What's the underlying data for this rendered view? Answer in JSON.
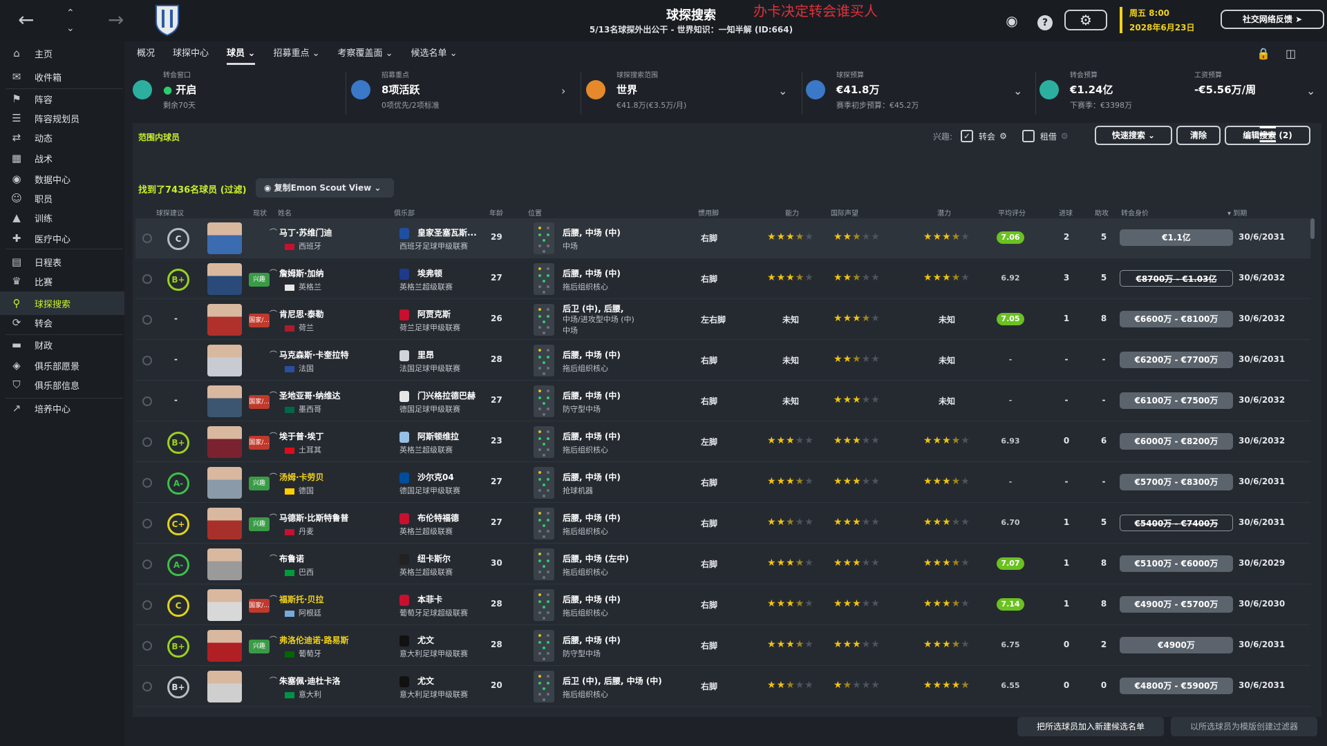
{
  "topbar": {
    "title": "球探搜索",
    "subtitle": "5/13名球探外出公干 - 世界知识：一知半解 (ID:664)",
    "overlay": "办卡决定转会谁买人",
    "date_line1": "周五 8:00",
    "date_line2": "2028年6月23日",
    "feedback": "社交网络反馈"
  },
  "sidebar": {
    "items": [
      {
        "label": "主页",
        "icon": "home-icon"
      },
      {
        "label": "收件箱",
        "icon": "inbox-icon"
      },
      {
        "label": "阵容",
        "icon": "shirt-icon"
      },
      {
        "label": "阵容规划员",
        "icon": "clipboard-icon"
      },
      {
        "label": "动态",
        "icon": "dynamics-icon"
      },
      {
        "label": "战术",
        "icon": "tactics-icon"
      },
      {
        "label": "数据中心",
        "icon": "data-icon"
      },
      {
        "label": "职员",
        "icon": "staff-icon"
      },
      {
        "label": "训练",
        "icon": "training-icon"
      },
      {
        "label": "医疗中心",
        "icon": "medical-icon"
      },
      {
        "label": "日程表",
        "icon": "calendar-icon"
      },
      {
        "label": "比赛",
        "icon": "trophy-icon"
      },
      {
        "label": "球探搜索",
        "icon": "search-icon"
      },
      {
        "label": "转会",
        "icon": "transfer-icon"
      },
      {
        "label": "财政",
        "icon": "finance-icon"
      },
      {
        "label": "俱乐部愿景",
        "icon": "vision-icon"
      },
      {
        "label": "俱乐部信息",
        "icon": "shield-icon"
      },
      {
        "label": "培养中心",
        "icon": "development-icon"
      }
    ]
  },
  "tabs": [
    "概况",
    "球探中心",
    "球员 ⌄",
    "招募重点 ⌄",
    "考察覆盖面 ⌄",
    "候选名单 ⌄"
  ],
  "summary": {
    "window": {
      "label": "转会窗口",
      "value": "开启",
      "sub": "剩余70天"
    },
    "focus": {
      "label": "招募重点",
      "value": "8项活跃",
      "sub": "0项优先/2项标准"
    },
    "range": {
      "label": "球探搜索范围",
      "value": "世界",
      "sub": "€41.8万(€3.5万/月)"
    },
    "budget": {
      "label": "球探预算",
      "value": "€41.8万",
      "sub": "赛季初步预算：€45.2万"
    },
    "transfer": {
      "label": "转会预算",
      "value": "€1.24亿",
      "sub": "下赛季：€3398万"
    },
    "wage": {
      "label": "工资预算",
      "value": "-€5.56万/周"
    }
  },
  "filters": {
    "in_range": "范围内球员",
    "interest_label": "兴趣:",
    "transfer": "转会",
    "loan": "租借",
    "quick_search": "快速搜索 ⌄",
    "clear": "清除",
    "edit_search": "编辑搜索 (2)"
  },
  "found": "找到了7436名球员 (过滤)",
  "view_button": "复制Emon Scout View ⌄",
  "headers": {
    "advice": "球探建议",
    "status": "现状",
    "name": "姓名",
    "club": "俱乐部",
    "age": "年龄",
    "position": "位置",
    "foot": "惯用脚",
    "ability": "能力",
    "reputation": "国际声望",
    "potential": "潜力",
    "avg": "平均评分",
    "goals": "进球",
    "assists": "助攻",
    "value": "转会身价",
    "expiry": "▾ 到期"
  },
  "players": [
    {
      "grade": "C",
      "gcolor": "#b8bcc1",
      "tag": "",
      "name": "马丁·苏维门迪",
      "fav": false,
      "nation": "西班牙",
      "fcol": "#c8102e",
      "club": "皇家圣塞瓦斯...",
      "league": "西班牙足球甲级联赛",
      "ccol": "#1f4fa0",
      "age": "29",
      "pos1": "后腰, 中场 (中)",
      "pos2": "中场",
      "foot": "右脚",
      "ability": 3.5,
      "rep": 2.5,
      "pot": 3.5,
      "avg": "7.06",
      "avgg": true,
      "goals": "2",
      "assists": "5",
      "value": "€1.1亿",
      "vstyle": "solid",
      "expiry": "30/6/2031",
      "photo": "#3b6bb0"
    },
    {
      "grade": "B+",
      "gcolor": "#9bd11e",
      "tag": "兴趣",
      "tagc": "#3a9b46",
      "name": "詹姆斯·加纳",
      "fav": false,
      "nation": "英格兰",
      "fcol": "#e8e8e8",
      "club": "埃弗顿",
      "league": "英格兰超级联赛",
      "ccol": "#1e3a8a",
      "age": "27",
      "pos1": "后腰, 中场 (中)",
      "pos2": "拖后组织核心",
      "foot": "右脚",
      "ability": 3.5,
      "rep": 2.5,
      "pot": 3.5,
      "avg": "6.92",
      "avgg": false,
      "goals": "3",
      "assists": "5",
      "value": "€8700万 - €1.03亿",
      "vstyle": "strike",
      "expiry": "30/6/2032",
      "photo": "#2a4a7a"
    },
    {
      "grade": "-",
      "gcolor": "",
      "tag": "国家/...",
      "tagc": "#c0392b",
      "name": "肯尼思·泰勒",
      "fav": false,
      "nation": "荷兰",
      "fcol": "#ae1c28",
      "club": "阿贾克斯",
      "league": "荷兰足球甲级联赛",
      "ccol": "#c8102e",
      "age": "26",
      "pos1": "后卫 (中), 后腰,",
      "pos2": "中场/进攻型中场 (中)",
      "pos3": "中场",
      "foot": "左右脚",
      "ability": 0,
      "rep": 3.5,
      "pot": 0,
      "avg": "7.05",
      "avgg": true,
      "goals": "1",
      "assists": "8",
      "value": "€6600万 - €8100万",
      "vstyle": "solid",
      "expiry": "30/6/2032",
      "photo": "#b0302c"
    },
    {
      "grade": "-",
      "gcolor": "",
      "tag": "",
      "name": "马克森斯·卡奎拉特",
      "fav": false,
      "nation": "法国",
      "fcol": "#2a4ea0",
      "club": "里昂",
      "league": "法国足球甲级联赛",
      "ccol": "#d0d4da",
      "age": "28",
      "pos1": "后腰, 中场 (中)",
      "pos2": "拖后组织核心",
      "foot": "右脚",
      "ability": 0,
      "rep": 2.5,
      "pot": 0,
      "avg": "-",
      "avgg": false,
      "goals": "-",
      "assists": "-",
      "value": "€6200万 - €7700万",
      "vstyle": "solid",
      "expiry": "30/6/2031",
      "photo": "#c8ccd2"
    },
    {
      "grade": "-",
      "gcolor": "",
      "tag": "国家/...",
      "tagc": "#c0392b",
      "name": "圣地亚哥·纳维达",
      "fav": false,
      "nation": "墨西哥",
      "fcol": "#006847",
      "club": "门兴格拉德巴赫",
      "league": "德国足球甲级联赛",
      "ccol": "#e6e6e6",
      "age": "27",
      "pos1": "后腰, 中场 (中)",
      "pos2": "防守型中场",
      "foot": "右脚",
      "ability": 0,
      "rep": 3,
      "pot": 0,
      "avg": "-",
      "avgg": false,
      "goals": "-",
      "assists": "-",
      "value": "€6100万 - €7500万",
      "vstyle": "solid",
      "expiry": "30/6/2032",
      "photo": "#3c5570"
    },
    {
      "grade": "B+",
      "gcolor": "#9bd11e",
      "tag": "国家/...",
      "tagc": "#c0392b",
      "name": "埃于普·埃丁",
      "fav": false,
      "nation": "土耳其",
      "fcol": "#e30a17",
      "club": "阿斯顿维拉",
      "league": "英格兰超级联赛",
      "ccol": "#95bfe5",
      "age": "23",
      "pos1": "后腰, 中场 (中)",
      "pos2": "拖后组织核心",
      "foot": "左脚",
      "ability": 3,
      "rep": 3,
      "pot": 3.5,
      "avg": "6.93",
      "avgg": false,
      "goals": "0",
      "assists": "6",
      "value": "€6000万 - €8200万",
      "vstyle": "solid",
      "expiry": "30/6/2032",
      "photo": "#7a2230"
    },
    {
      "grade": "A-",
      "gcolor": "#3fbf4a",
      "tag": "兴趣",
      "tagc": "#3a9b46",
      "name": "汤姆·卡劳贝",
      "fav": true,
      "nation": "德国",
      "fcol": "#ffce00",
      "club": "沙尔克04",
      "league": "德国足球甲级联赛",
      "ccol": "#004d9d",
      "age": "27",
      "pos1": "后腰, 中场 (中)",
      "pos2": "抢球机器",
      "foot": "右脚",
      "ability": 3.5,
      "rep": 3,
      "pot": 3.5,
      "avg": "-",
      "avgg": false,
      "goals": "-",
      "assists": "-",
      "value": "€5700万 - €8300万",
      "vstyle": "solid",
      "expiry": "30/6/2031",
      "photo": "#8a9aa8"
    },
    {
      "grade": "C+",
      "gcolor": "#e1d21a",
      "tag": "兴趣",
      "tagc": "#3a9b46",
      "name": "马德斯·比斯特鲁普",
      "fav": false,
      "nation": "丹麦",
      "fcol": "#c8102e",
      "club": "布伦特福德",
      "league": "英格兰超级联赛",
      "ccol": "#c8102e",
      "age": "27",
      "pos1": "后腰, 中场 (中)",
      "pos2": "拖后组织核心",
      "foot": "右脚",
      "ability": 2.5,
      "rep": 3,
      "pot": 3,
      "avg": "6.70",
      "avgg": false,
      "goals": "1",
      "assists": "5",
      "value": "€5400万 - €7400万",
      "vstyle": "strike",
      "expiry": "30/6/2031",
      "photo": "#a8302a"
    },
    {
      "grade": "A-",
      "gcolor": "#3fbf4a",
      "tag": "",
      "name": "布鲁诺",
      "fav": false,
      "nation": "巴西",
      "fcol": "#009c3b",
      "club": "纽卡斯尔",
      "league": "英格兰超级联赛",
      "ccol": "#222222",
      "age": "30",
      "pos1": "后腰, 中场 (左中)",
      "pos2": "拖后组织核心",
      "foot": "右脚",
      "ability": 3.5,
      "rep": 3,
      "pot": 3.5,
      "avg": "7.07",
      "avgg": true,
      "goals": "1",
      "assists": "8",
      "value": "€5100万 - €6000万",
      "vstyle": "solid",
      "expiry": "30/6/2029",
      "photo": "#9a9a9a"
    },
    {
      "grade": "C",
      "gcolor": "#e1d21a",
      "tag": "国家/...",
      "tagc": "#c0392b",
      "name": "福斯托·贝拉",
      "fav": true,
      "nation": "阿根廷",
      "fcol": "#75aadb",
      "club": "本菲卡",
      "league": "葡萄牙足球超级联赛",
      "ccol": "#c8102e",
      "age": "28",
      "pos1": "后腰, 中场 (中)",
      "pos2": "拖后组织核心",
      "foot": "右脚",
      "ability": 3.5,
      "rep": 3,
      "pot": 3.5,
      "avg": "7.14",
      "avgg": true,
      "goals": "1",
      "assists": "8",
      "value": "€4900万 - €5700万",
      "vstyle": "solid",
      "expiry": "30/6/2030",
      "photo": "#d8d8d8"
    },
    {
      "grade": "B+",
      "gcolor": "#9bd11e",
      "tag": "兴趣",
      "tagc": "#3a9b46",
      "name": "弗洛伦迪诺·路易斯",
      "fav": true,
      "nation": "葡萄牙",
      "fcol": "#006600",
      "club": "尤文",
      "league": "意大利足球甲级联赛",
      "ccol": "#111111",
      "age": "28",
      "pos1": "后腰, 中场 (中)",
      "pos2": "防守型中场",
      "foot": "右脚",
      "ability": 3.5,
      "rep": 3,
      "pot": 3.5,
      "avg": "6.75",
      "avgg": false,
      "goals": "0",
      "assists": "2",
      "value": "€4900万",
      "vstyle": "solid",
      "expiry": "30/6/2031",
      "photo": "#b01f24"
    },
    {
      "grade": "B+",
      "gcolor": "#b8bcc1",
      "tag": "",
      "name": "朱塞佩·迪杜卡洛",
      "fav": false,
      "nation": "意大利",
      "fcol": "#009246",
      "club": "尤文",
      "league": "意大利足球甲级联赛",
      "ccol": "#111111",
      "age": "20",
      "pos1": "后卫 (中), 后腰, 中场 (中)",
      "pos2": "拖后组织核心",
      "foot": "右脚",
      "ability": 2.5,
      "rep": 1.5,
      "pot": 4.5,
      "avg": "6.55",
      "avgg": false,
      "goals": "0",
      "assists": "0",
      "value": "€4800万 - €5900万",
      "vstyle": "solid",
      "expiry": "30/6/2031",
      "photo": "#cfcfcf"
    }
  ],
  "bottom": {
    "add_shortlist": "把所选球员加入新建候选名单",
    "create_filter": "以所选球员为模版创建过滤器"
  }
}
